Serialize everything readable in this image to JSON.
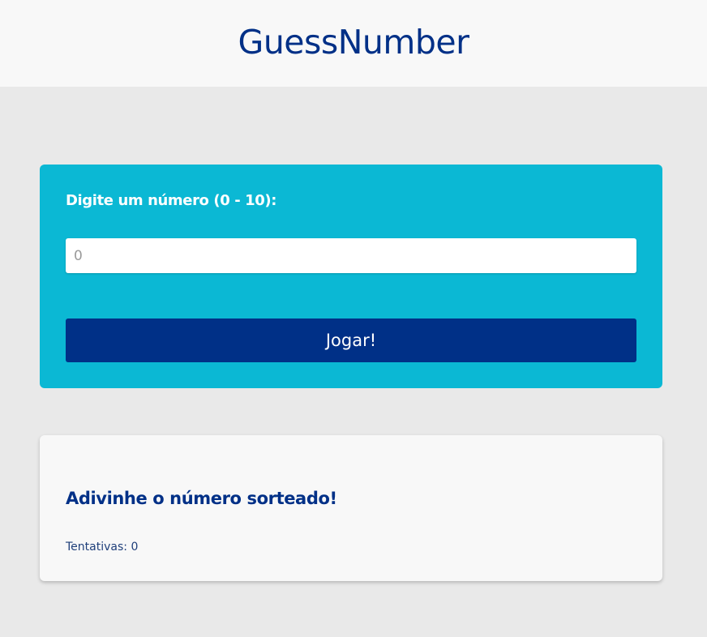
{
  "header": {
    "title": "GuessNumber"
  },
  "form": {
    "label": "Digite um número (0 - 10):",
    "input_placeholder": "0",
    "play_button_label": "Jogar!"
  },
  "result": {
    "title": "Adivinhe o número sorteado!",
    "attempts_label": "Tentativas:",
    "attempts_count": "0"
  },
  "colors": {
    "brand_blue": "#003087",
    "card_cyan": "#0bb8d4",
    "page_background": "#e9e9e9",
    "header_background": "#f8f8f8"
  }
}
